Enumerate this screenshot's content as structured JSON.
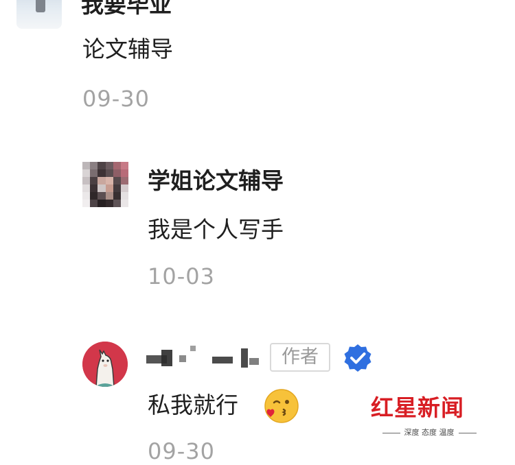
{
  "comments": [
    {
      "username": "我要毕业",
      "text": "论文辅导",
      "date": "09-30"
    },
    {
      "username": "学姐论文辅导",
      "text": "我是个人写手",
      "date": "10-03"
    },
    {
      "username_visible": false,
      "badge": "作者",
      "verified_icon": "verified-check-icon",
      "text": "私我就行",
      "emoji": "kissing-wink-emoji-icon",
      "date": "09-30"
    }
  ],
  "watermark": {
    "logo": "红星新闻",
    "slogan": "深度 态度 温度"
  },
  "colors": {
    "text": "#1f1f1f",
    "muted": "#a3a3a3",
    "verified": "#2f6fe0",
    "watermark_red": "#d81e24",
    "author_avatar": "#d2374a"
  }
}
